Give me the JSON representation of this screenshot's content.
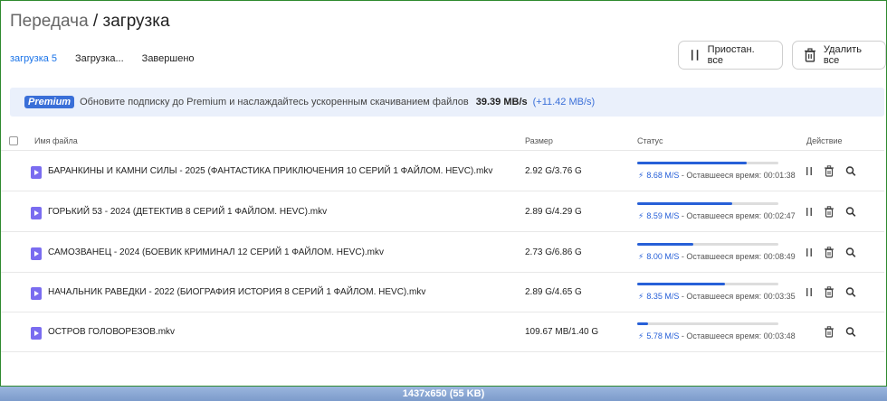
{
  "header": {
    "title_part1": "Передача",
    "separator": " / ",
    "title_part2": "загрузка"
  },
  "tabs": [
    {
      "label": "загрузка",
      "count": "5"
    },
    {
      "label": "Загрузка..."
    },
    {
      "label": "Завершено"
    }
  ],
  "actions": {
    "pause_all": "Приостан. все",
    "delete_all": "Удалить все"
  },
  "banner": {
    "badge": "Premium",
    "text": "Обновите подписку до Premium и наслаждайтесь ускоренным скачиванием файлов",
    "speed": "39.39 MB/s",
    "boost": "(+11.42 MB/s)"
  },
  "table": {
    "headers": {
      "name": "Имя файла",
      "size": "Размер",
      "status": "Статус",
      "action": "Действие"
    },
    "rows": [
      {
        "name": "БАРАНКИНЫ И КАМНИ СИЛЫ - 2025 (ФАНТАСТИКА ПРИКЛЮЧЕНИЯ 10 СЕРИЙ 1 ФАЙЛОМ. HEVC).mkv",
        "size": "2.92 G/3.76 G",
        "rate": "8.68 M/S",
        "remaining": " - Оставшееся время: 00:01:38",
        "progress": 0.776
      },
      {
        "name": "ГОРЬКИЙ 53 - 2024 (ДЕТЕКТИВ 8 СЕРИЙ 1 ФАЙЛОМ. HEVC).mkv",
        "size": "2.89 G/4.29 G",
        "rate": "8.59 M/S",
        "remaining": " - Оставшееся время: 00:02:47",
        "progress": 0.673
      },
      {
        "name": "САМОЗВАНЕЦ - 2024 (БОЕВИК КРИМИНАЛ 12 СЕРИЙ 1 ФАЙЛОМ. HEVC).mkv",
        "size": "2.73 G/6.86 G",
        "rate": "8.00 M/S",
        "remaining": " - Оставшееся время: 00:08:49",
        "progress": 0.398
      },
      {
        "name": "НАЧАЛЬНИК РАВЕДКИ - 2022 (БИОГРАФИЯ ИСТОРИЯ 8 СЕРИЙ 1 ФАЙЛОМ. HEVC).mkv",
        "size": "2.89 G/4.65 G",
        "rate": "8.35 M/S",
        "remaining": " - Оставшееся время: 00:03:35",
        "progress": 0.621
      },
      {
        "name": "ОСТРОВ ГОЛОВОРЕЗОВ.mkv",
        "size": "109.67 MB/1.40 G",
        "rate": "5.78 M/S",
        "remaining": " - Оставшееся время: 00:03:48",
        "progress": 0.076
      }
    ]
  },
  "footer": {
    "info": "1437x650 (55 KB)"
  },
  "colors": {
    "accent": "#2760d8",
    "frame": "#2f8a2f",
    "banner_bg": "#eaf0fb",
    "file_icon": "#7a6cf0"
  },
  "icons": {
    "pause": "pause-icon",
    "trash": "trash-icon",
    "search": "search-icon",
    "file": "video-file-icon",
    "bolt": "bolt-icon"
  }
}
